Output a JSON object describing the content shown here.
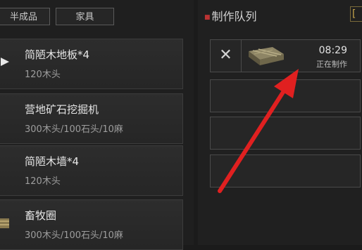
{
  "tabs": [
    {
      "label": "半成品"
    },
    {
      "label": "家具"
    }
  ],
  "recipes": [
    {
      "name": "简陋木地板*4",
      "cost": "120木头"
    },
    {
      "name": "营地矿石挖掘机",
      "cost": "300木头/100石头/10麻"
    },
    {
      "name": "简陋木墙*4",
      "cost": "120木头"
    },
    {
      "name": "畜牧圈",
      "cost": "300木头/100石头/10麻"
    }
  ],
  "queue": {
    "title": "制作队列",
    "active": {
      "timer": "08:29",
      "status": "正在制作"
    }
  },
  "colors": {
    "arrow": "#e02020",
    "accent": "#c8a64a"
  }
}
